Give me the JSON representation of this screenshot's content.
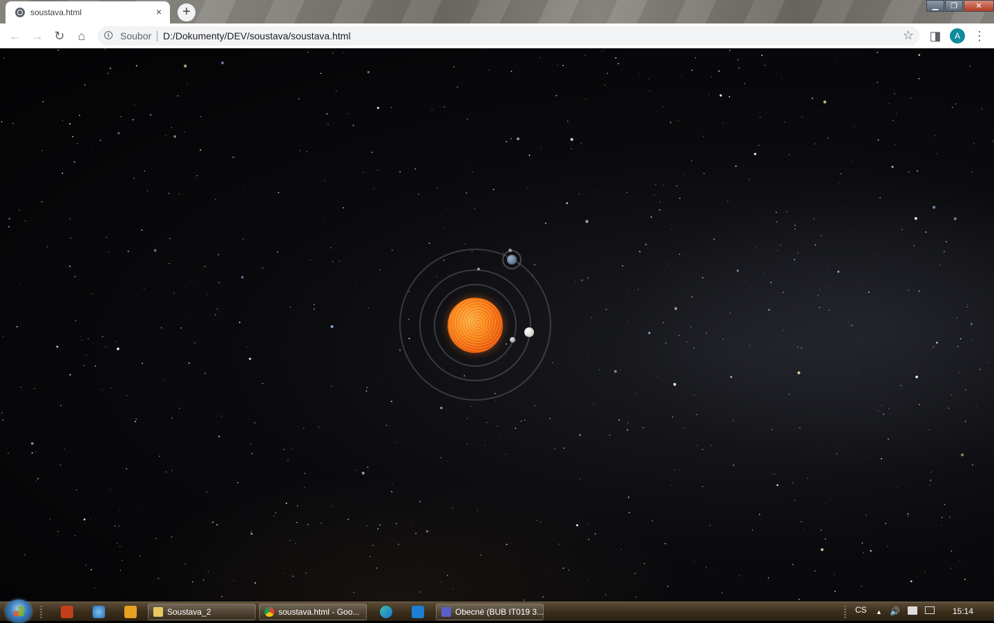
{
  "browser": {
    "tab_title": "soustava.html",
    "tab_close": "×",
    "new_tab": "+",
    "window_buttons": {
      "minimize": "▁",
      "restore": "❐",
      "close": "✕"
    },
    "nav": {
      "back": "←",
      "forward": "→",
      "reload": "↻",
      "home": "⌂"
    },
    "omnibox": {
      "info_glyph": "i",
      "scheme_label": "Soubor",
      "url": "D:/Dokumenty/DEV/soustava/soustava.html",
      "bookmark": "☆"
    },
    "toolbar_right": {
      "sidepanel": "◨",
      "avatar_letter": "A",
      "menu": "⋮"
    }
  },
  "scene": {
    "planets": [
      "sun",
      "mercury",
      "venus",
      "earth",
      "moon"
    ],
    "colors": {
      "sun": "#ef5a0a",
      "orbit": "#6e6e6e",
      "sky": "#030304"
    }
  },
  "taskbar": {
    "start": "start-orb",
    "quick_launch": [
      "powerpoint-icon",
      "internet-explorer-icon",
      "media-player-icon"
    ],
    "buttons": [
      {
        "label": "Soustava_2",
        "icon": "folder-icon"
      },
      {
        "label": "soustava.html - Goo...",
        "icon": "chrome-icon"
      },
      {
        "label": "",
        "icon": "edge-icon"
      },
      {
        "label": "",
        "icon": "vscode-icon"
      },
      {
        "label": "Obecné (BUB IT019 3...",
        "icon": "teams-icon"
      }
    ],
    "tray": {
      "language": "CS",
      "show_hidden": "▲",
      "volume": "🔊",
      "time": "15:14"
    }
  }
}
